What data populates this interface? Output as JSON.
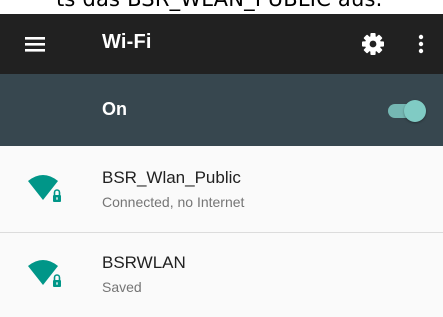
{
  "caption_fragment": "ts das BSR_WLAN_PUBLIC aus.",
  "toolbar": {
    "title": "Wi-Fi",
    "menu_icon": "hamburger-menu-icon",
    "settings_icon": "gear-icon",
    "overflow_icon": "more-vert-icon"
  },
  "master_switch": {
    "label": "On",
    "checked": true,
    "color": "#80cbc4"
  },
  "networks": [
    {
      "name": "BSR_Wlan_Public",
      "status": "Connected, no Internet",
      "icon": "wifi-lock-icon"
    },
    {
      "name": "BSRWLAN",
      "status": "Saved",
      "icon": "wifi-lock-icon"
    }
  ],
  "colors": {
    "toolbar": "#212121",
    "master_bar": "#37474f",
    "accent": "#009688",
    "background": "#fafafa"
  }
}
